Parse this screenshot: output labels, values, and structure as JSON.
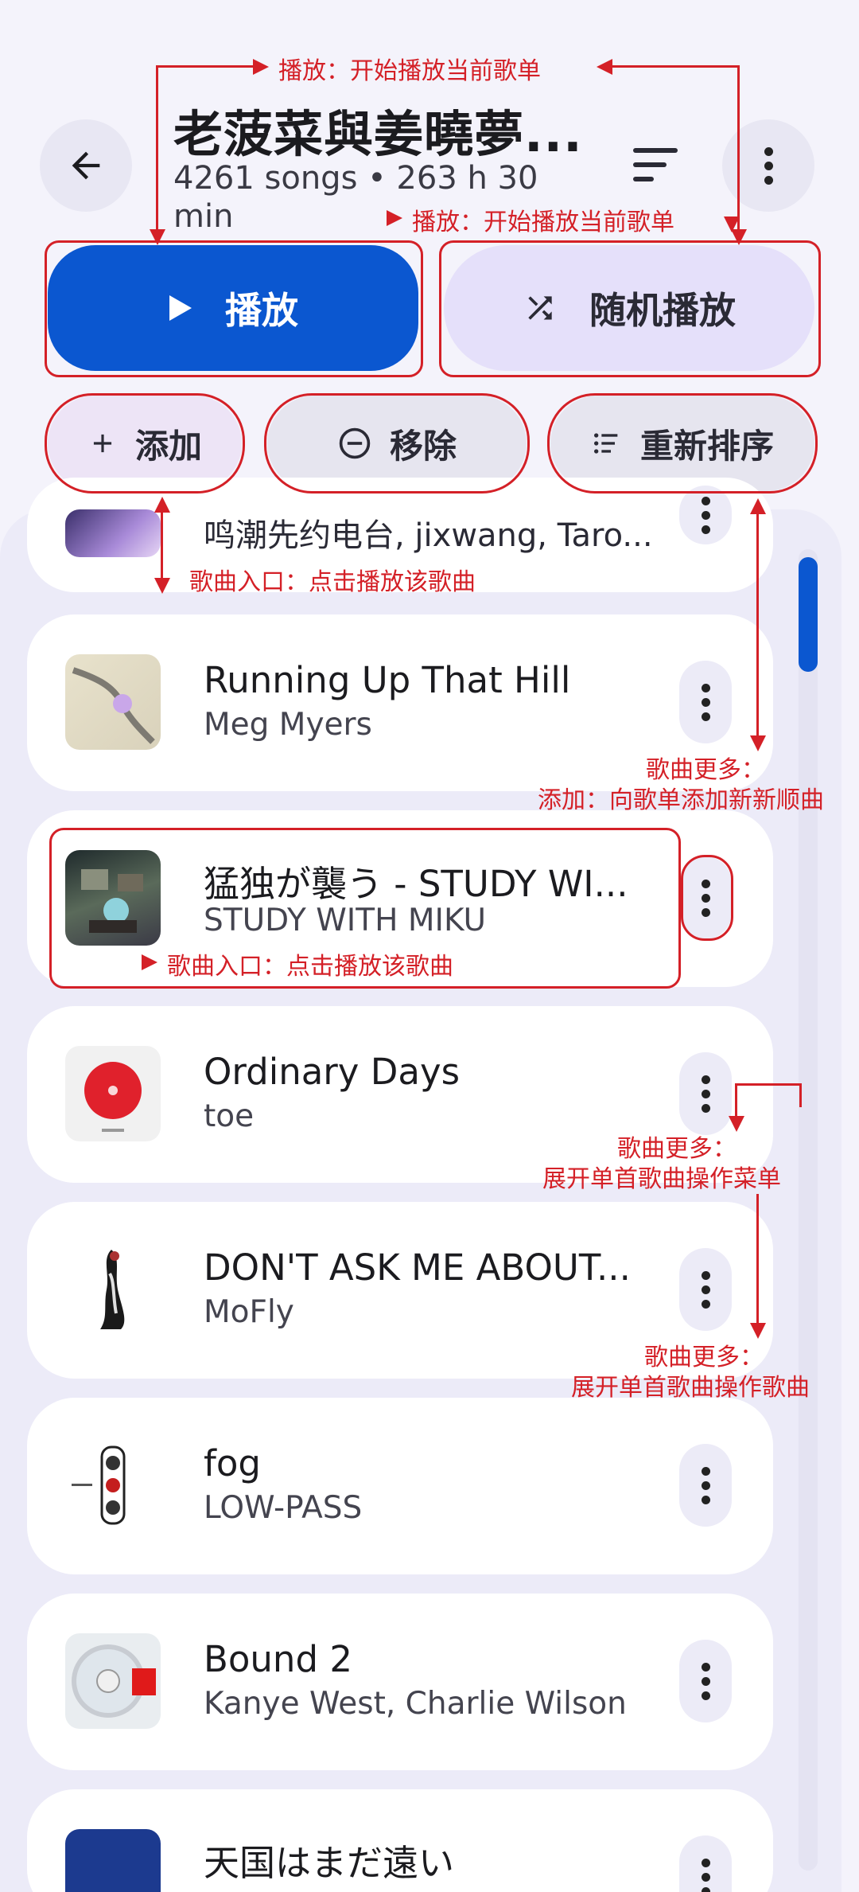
{
  "header": {
    "title": "老菠菜與姜曉夢...",
    "subtitle": "4261 songs • 263 h 30 min"
  },
  "actions": {
    "play_label": "播放",
    "shuffle_label": "随机播放",
    "add_label": "添加",
    "remove_label": "移除",
    "reorder_label": "重新排序"
  },
  "songs": [
    {
      "title": "",
      "artist": "鸣潮先约电台, jixwang, Taro..."
    },
    {
      "title": "Running Up That Hill",
      "artist": "Meg Myers"
    },
    {
      "title": "猛独が襲う - STUDY WI...",
      "artist": "STUDY WITH MIKU"
    },
    {
      "title": "Ordinary Days",
      "artist": "toe"
    },
    {
      "title": "DON'T ASK ME ABOUT...",
      "artist": "MoFly"
    },
    {
      "title": "fog",
      "artist": "LOW-PASS"
    },
    {
      "title": "Bound 2",
      "artist": "Kanye West, Charlie Wilson"
    },
    {
      "title": "天国はまだ遠い",
      "artist": ""
    }
  ],
  "annotations": {
    "play_top": "播放：开始播放当前歌单",
    "play_right": "播放：开始播放当前歌单",
    "song_entry_1": "歌曲入口：点击播放该歌曲",
    "song_more_1a": "歌曲更多：",
    "song_more_1b": "添加：向歌单添加新新顺曲",
    "song_entry_2": "歌曲入口：点击播放该歌曲",
    "song_more_2a": "歌曲更多：",
    "song_more_2b": "展开单首歌曲操作菜单",
    "song_more_3a": "歌曲更多：",
    "song_more_3b": "展开单首歌曲操作歌曲"
  },
  "colors": {
    "accent": "#0b57d0",
    "annotation": "#d42027",
    "background": "#f4f3fb"
  }
}
